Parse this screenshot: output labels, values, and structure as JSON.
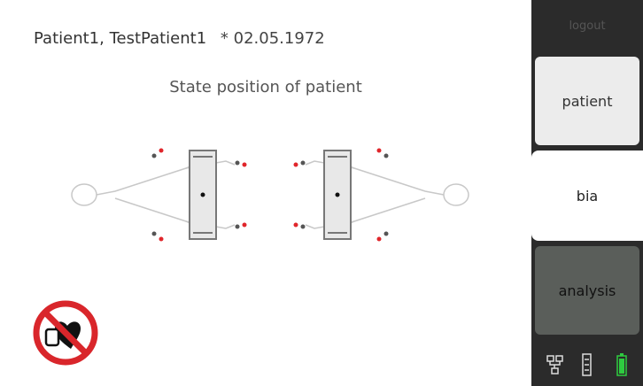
{
  "header": {
    "patient_name": "Patient1, TestPatient1",
    "date_of_birth": "* 02.05.1972"
  },
  "instruction": "State position of patient",
  "sidebar": {
    "logout_label": "logout",
    "tabs": [
      {
        "label": "patient",
        "active": false
      },
      {
        "label": "bia",
        "active": true
      },
      {
        "label": "analysis",
        "active": false
      }
    ],
    "status_icons": [
      "network-icon",
      "scale-icon",
      "battery-icon"
    ]
  },
  "colors": {
    "sidebar_bg": "#2b2b2b",
    "electrode_red": "#e0262b",
    "battery_green": "#2ecc40",
    "warning_red": "#d9262b"
  },
  "icons": {
    "warning": "pacemaker-prohibited-icon"
  }
}
